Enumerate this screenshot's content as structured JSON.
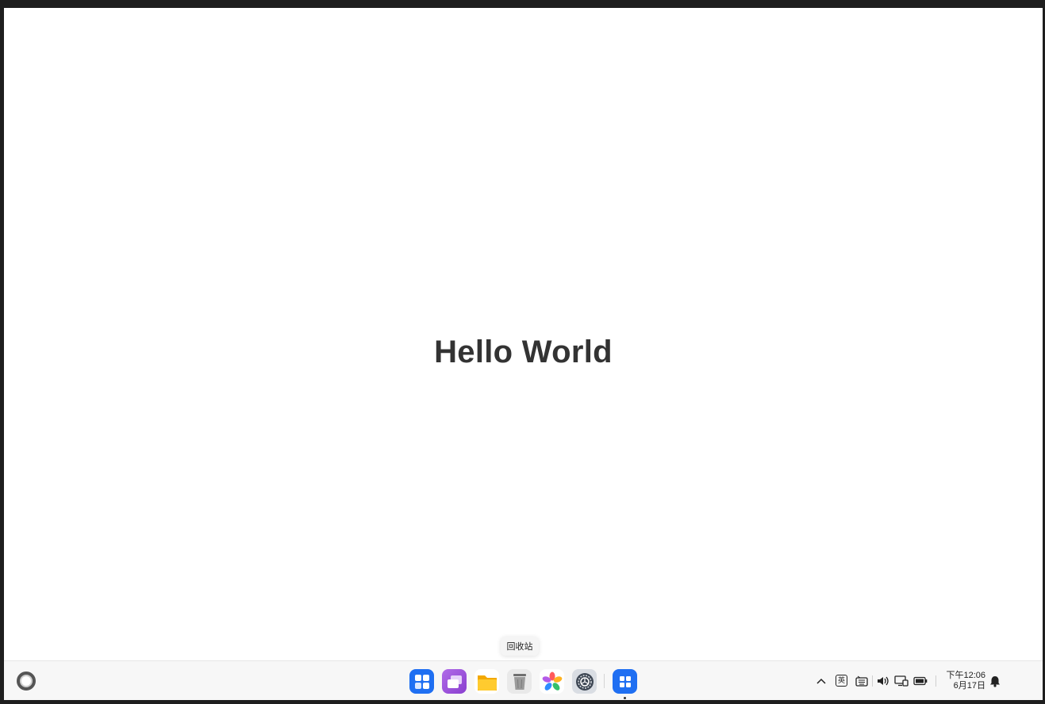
{
  "desktop": {
    "hello_text": "Hello World"
  },
  "tooltip": {
    "text": "回收站"
  },
  "taskbar": {
    "start_icon": "launcher-ring-icon",
    "dock": [
      {
        "icon": "launcher-grid-icon",
        "color": "#1f6ff2"
      },
      {
        "icon": "multitask-icon",
        "color": "#9a56d6"
      },
      {
        "icon": "file-manager-icon",
        "color": "#f7b500"
      },
      {
        "icon": "trash-icon",
        "color": "#8c8c8c"
      },
      {
        "icon": "photos-icon",
        "color": "#ff4d6d"
      },
      {
        "icon": "settings-icon",
        "color": "#3d4653"
      },
      {
        "icon": "app-grid-icon",
        "color": "#1f6ff2"
      }
    ],
    "tray": {
      "ime_label": "英",
      "icons": [
        "chevron-up-icon",
        "keyboard-icon",
        "volume-icon",
        "display-icon",
        "battery-icon",
        "bell-icon"
      ]
    },
    "clock": {
      "time": "下午12:06",
      "date": "6月17日"
    }
  }
}
